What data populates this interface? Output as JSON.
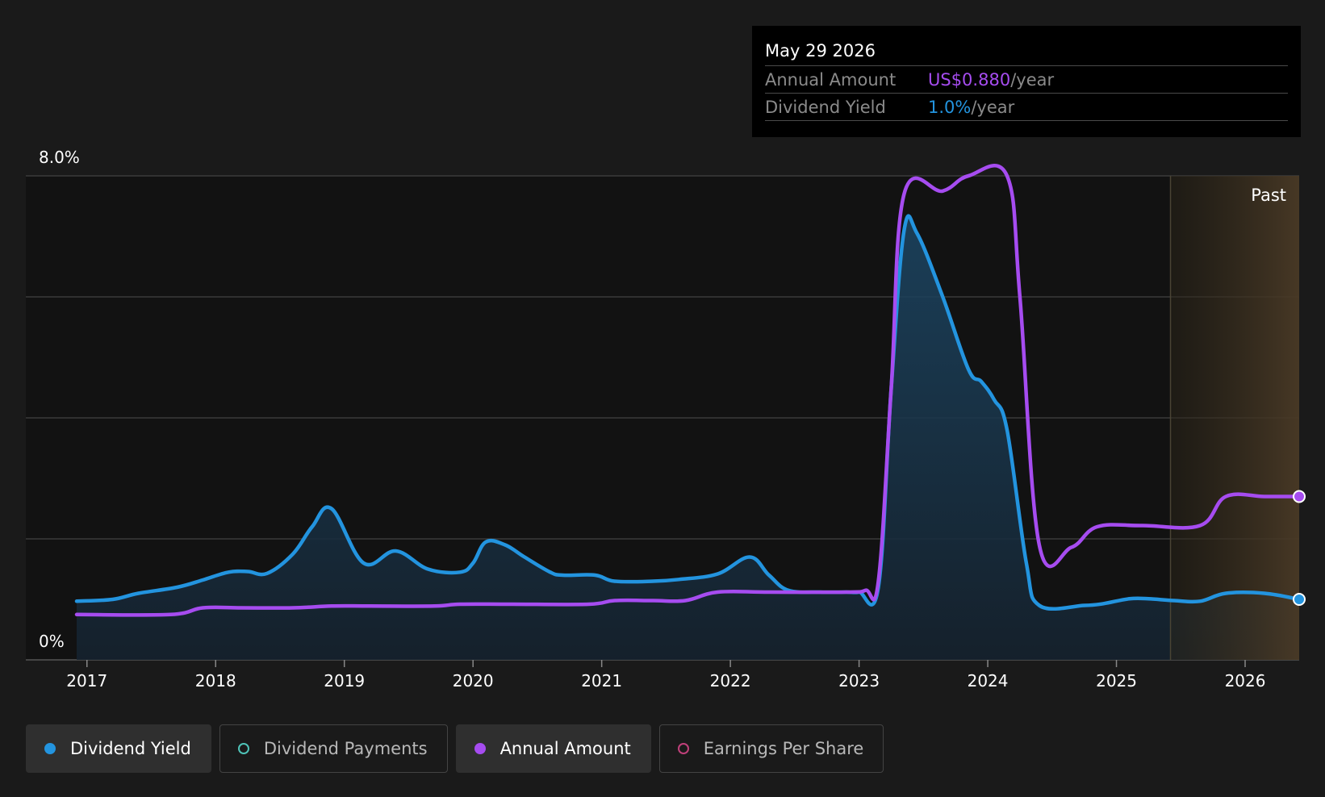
{
  "tooltip": {
    "date": "May 29 2026",
    "rows": [
      {
        "label": "Annual Amount",
        "value": "US$0.880",
        "unit": "/year",
        "color": "#a64cf0"
      },
      {
        "label": "Dividend Yield",
        "value": "1.0%",
        "unit": "/year",
        "color": "#2394df"
      }
    ]
  },
  "legend": [
    {
      "label": "Dividend Yield",
      "color": "#2394df",
      "marker": "filled",
      "active": true
    },
    {
      "label": "Dividend Payments",
      "color": "#4fc3b8",
      "marker": "ring",
      "active": false
    },
    {
      "label": "Annual Amount",
      "color": "#a64cf0",
      "marker": "filled",
      "active": true
    },
    {
      "label": "Earnings Per Share",
      "color": "#c0407a",
      "marker": "ring",
      "active": false
    }
  ],
  "chart_data": {
    "type": "line",
    "y_tick_labels": [
      "8.0%",
      "0%"
    ],
    "ylim": [
      0,
      8
    ],
    "xlim": [
      2016.92,
      2026.42
    ],
    "x_ticks": [
      2017,
      2018,
      2019,
      2020,
      2021,
      2022,
      2023,
      2024,
      2025,
      2026
    ],
    "x_tick_labels": [
      "2017",
      "2018",
      "2019",
      "2020",
      "2021",
      "2022",
      "2023",
      "2024",
      "2025",
      "2026"
    ],
    "grid": true,
    "region": {
      "label": "Past",
      "from": 2025.42,
      "to": 2026.42
    },
    "series": [
      {
        "name": "Dividend Yield",
        "color": "#2394df",
        "area": true,
        "points": [
          [
            2016.92,
            0.97
          ],
          [
            2017.2,
            1.0
          ],
          [
            2017.4,
            1.1
          ],
          [
            2017.7,
            1.2
          ],
          [
            2017.9,
            1.32
          ],
          [
            2018.1,
            1.45
          ],
          [
            2018.25,
            1.46
          ],
          [
            2018.4,
            1.43
          ],
          [
            2018.6,
            1.75
          ],
          [
            2018.75,
            2.2
          ],
          [
            2018.9,
            2.5
          ],
          [
            2019.15,
            1.6
          ],
          [
            2019.4,
            1.8
          ],
          [
            2019.65,
            1.5
          ],
          [
            2019.9,
            1.45
          ],
          [
            2020.0,
            1.6
          ],
          [
            2020.1,
            1.95
          ],
          [
            2020.25,
            1.9
          ],
          [
            2020.4,
            1.7
          ],
          [
            2020.6,
            1.45
          ],
          [
            2020.7,
            1.4
          ],
          [
            2020.95,
            1.4
          ],
          [
            2021.1,
            1.3
          ],
          [
            2021.4,
            1.3
          ],
          [
            2021.6,
            1.33
          ],
          [
            2021.9,
            1.42
          ],
          [
            2022.15,
            1.7
          ],
          [
            2022.3,
            1.4
          ],
          [
            2022.45,
            1.15
          ],
          [
            2022.7,
            1.12
          ],
          [
            2022.9,
            1.12
          ],
          [
            2023.0,
            1.12
          ],
          [
            2023.15,
            1.2
          ],
          [
            2023.25,
            4.5
          ],
          [
            2023.35,
            7.1
          ],
          [
            2023.45,
            7.05
          ],
          [
            2023.65,
            6.0
          ],
          [
            2023.85,
            4.8
          ],
          [
            2023.95,
            4.6
          ],
          [
            2024.05,
            4.3
          ],
          [
            2024.15,
            3.8
          ],
          [
            2024.3,
            1.6
          ],
          [
            2024.4,
            0.9
          ],
          [
            2024.75,
            0.9
          ],
          [
            2024.9,
            0.93
          ],
          [
            2025.1,
            1.01
          ],
          [
            2025.25,
            1.01
          ],
          [
            2025.45,
            0.98
          ],
          [
            2025.65,
            0.97
          ],
          [
            2025.85,
            1.1
          ],
          [
            2026.15,
            1.1
          ],
          [
            2026.42,
            1.0
          ]
        ]
      },
      {
        "name": "Annual Amount",
        "color": "#a64cf0",
        "area": false,
        "points": [
          [
            2016.92,
            0.75
          ],
          [
            2017.65,
            0.75
          ],
          [
            2017.9,
            0.86
          ],
          [
            2018.2,
            0.86
          ],
          [
            2018.6,
            0.86
          ],
          [
            2018.9,
            0.89
          ],
          [
            2019.2,
            0.89
          ],
          [
            2019.7,
            0.89
          ],
          [
            2019.9,
            0.92
          ],
          [
            2020.3,
            0.92
          ],
          [
            2020.9,
            0.92
          ],
          [
            2021.1,
            0.98
          ],
          [
            2021.4,
            0.98
          ],
          [
            2021.65,
            0.98
          ],
          [
            2021.9,
            1.12
          ],
          [
            2022.3,
            1.12
          ],
          [
            2022.9,
            1.12
          ],
          [
            2023.05,
            1.15
          ],
          [
            2023.15,
            1.3
          ],
          [
            2023.25,
            4.5
          ],
          [
            2023.35,
            7.7
          ],
          [
            2023.65,
            7.75
          ],
          [
            2023.85,
            8.0
          ],
          [
            2024.15,
            8.0
          ],
          [
            2024.25,
            6.0
          ],
          [
            2024.4,
            1.9
          ],
          [
            2024.65,
            1.86
          ],
          [
            2024.85,
            2.2
          ],
          [
            2025.2,
            2.22
          ],
          [
            2025.65,
            2.22
          ],
          [
            2025.85,
            2.7
          ],
          [
            2026.15,
            2.7
          ],
          [
            2026.42,
            2.7
          ]
        ]
      }
    ]
  }
}
